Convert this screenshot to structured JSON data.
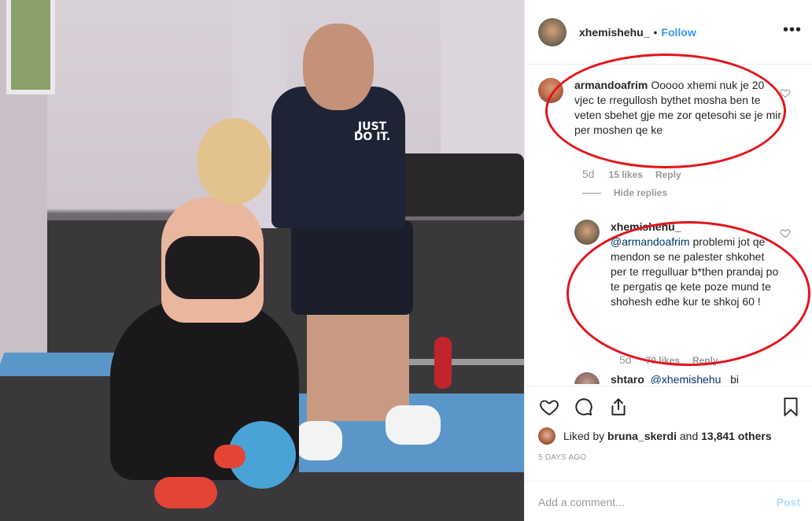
{
  "photo": {
    "shirt_text": "JUST DO IT."
  },
  "post": {
    "author": "xhemishehu_",
    "separator": "•",
    "follow_label": "Follow",
    "more_label": "•••"
  },
  "comments": [
    {
      "username": "armandoafrim",
      "text": "Ooooo xhemi nuk je 20 vjec te rregullosh bythet mosha ben te veten sbehet gje me zor qetesohi se je mir per moshen qe ke",
      "time": "5d",
      "likes": "15 likes",
      "reply_label": "Reply",
      "hide_replies_label": "Hide replies"
    },
    {
      "username": "xhemishehu_",
      "mention": "@armandoafrim",
      "text": "problemi jot qe mendon se ne palester shkohet per te rregulluar b*then prandaj po te pergatis qe kete poze mund te shohesh edhe kur te shkoj 60 !",
      "time": "5d",
      "likes": "70 likes",
      "reply_label": "Reply"
    },
    {
      "username": "shtaro",
      "mention": "@xhemishehu_",
      "text": "bi"
    }
  ],
  "actions": {
    "liked_by_prefix": "Liked by ",
    "liked_by_user": "bruna_skerdi",
    "liked_by_middle": " and ",
    "liked_by_count": "13,841 others",
    "timestamp": "5 DAYS AGO",
    "comment_placeholder": "Add a comment...",
    "post_label": "Post"
  },
  "icons": {
    "like": "heart-icon",
    "comment": "comment-bubble-icon",
    "share": "share-icon",
    "save": "bookmark-icon",
    "more": "more-options-icon"
  },
  "colors": {
    "follow_blue": "#3897f0",
    "annotation_red": "#e0161c",
    "muted_text": "#999999"
  }
}
